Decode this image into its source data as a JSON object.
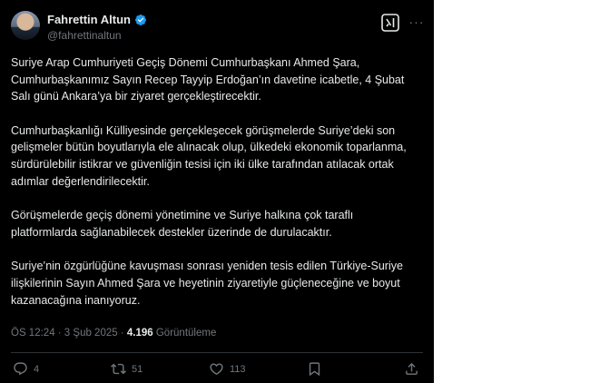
{
  "author": {
    "name": "Fahrettin Altun",
    "handle": "@fahrettinaltun",
    "verified_badge": "verified-badge-icon"
  },
  "toolbar": {
    "grok_icon": "grok-icon",
    "more_icon": "more-options-icon"
  },
  "post": {
    "paragraphs": [
      "Suriye Arap Cumhuriyeti Geçiş Dönemi Cumhurbaşkanı Ahmed Şara, Cumhurbaşkanımız Sayın Recep Tayyip Erdoğan’ın davetine icabetle, 4 Şubat Salı günü Ankara’ya bir ziyaret gerçekleştirecektir.",
      "Cumhurbaşkanlığı Külliyesinde gerçekleşecek görüşmelerde Suriye’deki son gelişmeler bütün boyutlarıyla ele alınacak olup, ülkedeki ekonomik toparlanma, sürdürülebilir istikrar ve güvenliğin tesisi için iki ülke tarafından atılacak ortak adımlar değerlendirilecektir.",
      "Görüşmelerde geçiş dönemi yönetimine ve Suriye halkına çok taraflı platformlarda sağlanabilecek destekler üzerinde de durulacaktır.",
      "Suriye’nin özgürlüğüne kavuşması sonrası yeniden tesis edilen Türkiye-Suriye ilişkilerinin Sayın Ahmed Şara ve heyetinin ziyaretiyle güçleneceğine ve boyut kazanacağına inanıyoruz."
    ],
    "timestamp": "ÖS 12:24 · 3 Şub 2025 ·",
    "views_count": "4.196",
    "views_label": "Görüntüleme"
  },
  "actions": {
    "replies": "4",
    "reposts": "51",
    "likes": "113"
  },
  "colors": {
    "background": "#000000",
    "text": "#e7e9ea",
    "secondary": "#71767b",
    "verified": "#1d9bf0"
  }
}
